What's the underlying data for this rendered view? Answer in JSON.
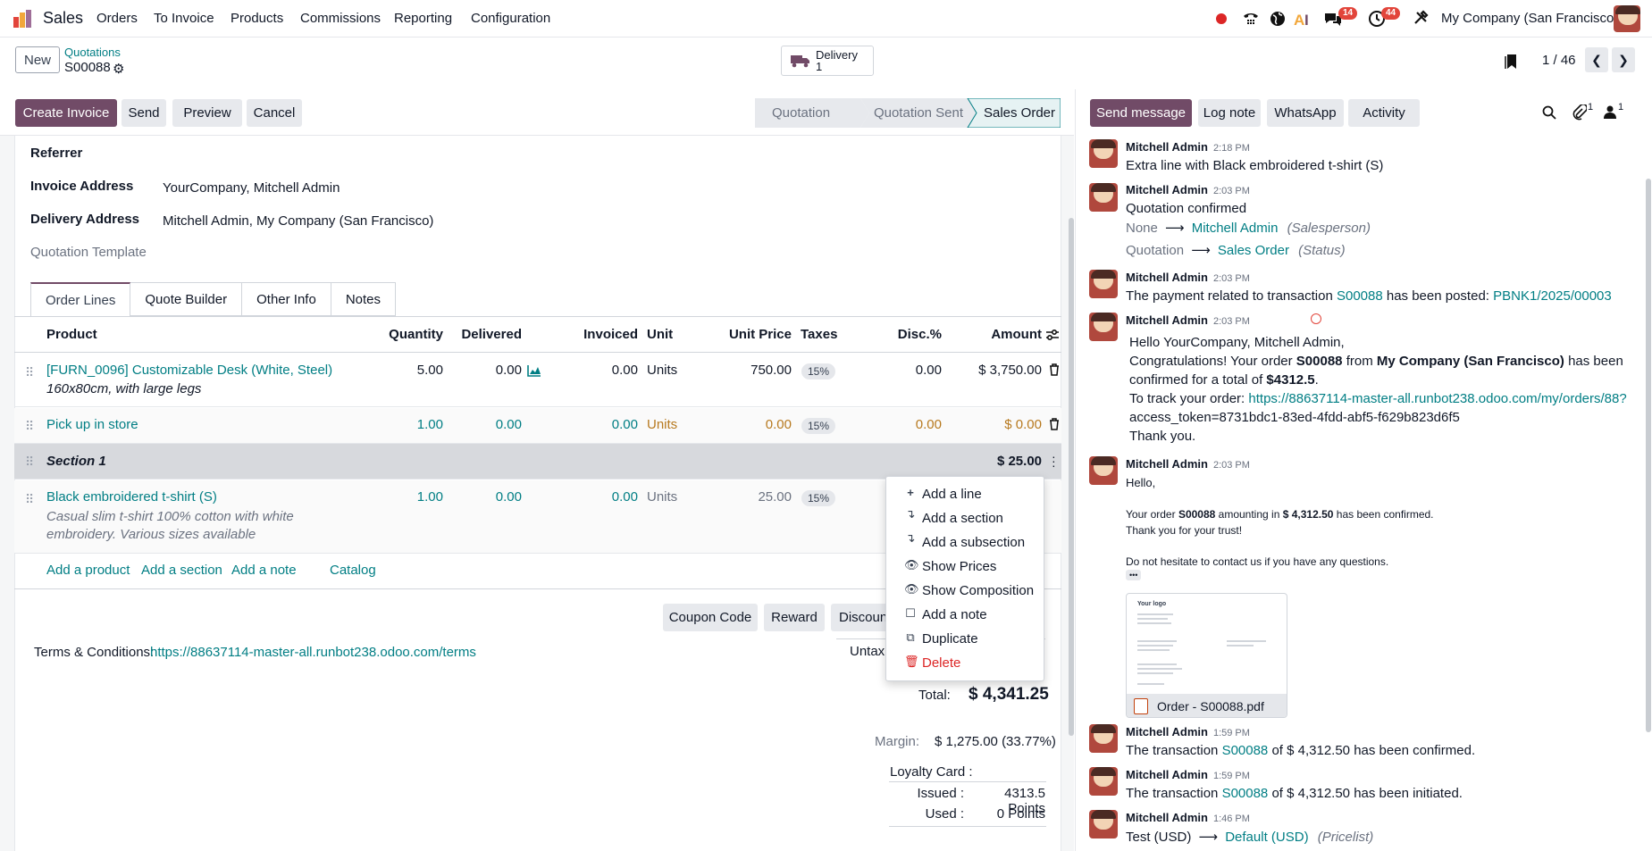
{
  "nav": {
    "app_name": "Sales",
    "menu": [
      "Orders",
      "To Invoice",
      "Products",
      "Commissions",
      "Reporting",
      "Configuration"
    ],
    "chat_count": "14",
    "activity_count": "44",
    "company": "My Company (San Francisco)"
  },
  "control": {
    "new_label": "New",
    "breadcrumb_parent": "Quotations",
    "record_name": "S00088",
    "delivery_label": "Delivery",
    "delivery_count": "1",
    "pager": "1 / 46"
  },
  "actions": {
    "create_invoice": "Create Invoice",
    "send": "Send",
    "preview": "Preview",
    "cancel": "Cancel"
  },
  "status": {
    "steps": [
      "Quotation",
      "Quotation Sent",
      "Sales Order"
    ],
    "active": "Sales Order"
  },
  "fields": {
    "referrer_label": "Referrer",
    "invoice_address_label": "Invoice Address",
    "invoice_address_value": "YourCompany, Mitchell Admin",
    "delivery_address_label": "Delivery Address",
    "delivery_address_value": "Mitchell Admin, My Company (San Francisco)",
    "quotation_template_label": "Quotation Template"
  },
  "tabs": [
    "Order Lines",
    "Quote Builder",
    "Other Info",
    "Notes"
  ],
  "columns": {
    "product": "Product",
    "quantity": "Quantity",
    "delivered": "Delivered",
    "invoiced": "Invoiced",
    "unit": "Unit",
    "unit_price": "Unit Price",
    "taxes": "Taxes",
    "disc": "Disc.%",
    "amount": "Amount"
  },
  "lines": [
    {
      "product": "[FURN_0096] Customizable Desk (White, Steel)",
      "desc": "160x80cm, with large legs",
      "qty": "5.00",
      "delivered": "0.00",
      "invoiced": "0.00",
      "unit": "Units",
      "price": "750.00",
      "tax": "15%",
      "disc": "0.00",
      "amount": "$ 3,750.00"
    },
    {
      "product": "Pick up in store",
      "qty": "1.00",
      "delivered": "0.00",
      "invoiced": "0.00",
      "unit": "Units",
      "price": "0.00",
      "tax": "15%",
      "disc": "0.00",
      "amount": "$ 0.00"
    },
    {
      "section": "Section 1",
      "amount": "$ 25.00"
    },
    {
      "product": "Black embroidered t-shirt (S)",
      "desc1": "Casual slim t-shirt 100% cotton with white",
      "desc2": "embroidery. Various sizes available",
      "qty": "1.00",
      "delivered": "0.00",
      "invoiced": "0.00",
      "unit": "Units",
      "price": "25.00",
      "tax": "15%"
    }
  ],
  "add_links": {
    "product": "Add a product",
    "section": "Add a section",
    "note": "Add a note",
    "catalog": "Catalog"
  },
  "footer_buttons": {
    "coupon": "Coupon Code",
    "reward": "Reward",
    "discount": "Discoun"
  },
  "terms": {
    "label": "Terms & Conditions:",
    "url": "https://88637114-master-all.runbot238.odoo.com/terms"
  },
  "totals": {
    "untaxed_label": "Untax",
    "total_label": "Total:",
    "total_value": "$ 4,341.25",
    "margin_label": "Margin:",
    "margin_value": "$ 1,275.00 (33.77%)",
    "loyalty_label": "Loyalty Card :",
    "issued_label": "Issued :",
    "issued_value": "4313.5 Points",
    "used_label": "Used :",
    "used_value": "0 Points"
  },
  "context_menu": [
    "Add a line",
    "Add a section",
    "Add a subsection",
    "Show Prices",
    "Show Composition",
    "Add a note",
    "Duplicate",
    "Delete"
  ],
  "chatter": {
    "send_message": "Send message",
    "log_note": "Log note",
    "whatsapp": "WhatsApp",
    "activity": "Activity",
    "attachments_count": "1",
    "followers_count": "1"
  },
  "messages": {
    "m1": {
      "author": "Mitchell Admin",
      "time": "2:18 PM",
      "text": "Extra line with Black embroidered t-shirt (S)"
    },
    "m2": {
      "author": "Mitchell Admin",
      "time": "2:03 PM",
      "text": "Quotation confirmed",
      "t1_from": "None",
      "t1_to": "Mitchell Admin",
      "t1_field": "(Salesperson)",
      "t2_from": "Quotation",
      "t2_to": "Sales Order",
      "t2_field": "(Status)"
    },
    "m3": {
      "author": "Mitchell Admin",
      "time": "2:03 PM",
      "pre": "The payment related to transaction",
      "ref": "S00088",
      "mid": "has been posted:",
      "link": "PBNK1/2025/00003"
    },
    "m4": {
      "author": "Mitchell Admin",
      "time": "2:03 PM",
      "l1": "Hello YourCompany, Mitchell Admin,",
      "l2a": "Congratulations! Your order",
      "l2b": "S00088",
      "l2c": "from",
      "l2d": "My Company (San Francisco)",
      "l2e": "has been",
      "l3a": "confirmed for a total of",
      "l3b": "$4312.5",
      "l3c": ".",
      "l4a": "To track your order:",
      "l4b": "https://88637114-master-all.runbot238.odoo.com/my/orders/88?",
      "l5": "access_token=8731bdc1-83ed-4fdd-abf5-f629b823d6f5",
      "l6": "Thank you."
    },
    "m5": {
      "author": "Mitchell Admin",
      "time": "2:03 PM",
      "l1": "Hello,",
      "l2a": "Your order",
      "l2b": "S00088",
      "l2c": "amounting in",
      "l2d": "$ 4,312.50",
      "l2e": "has been confirmed.",
      "l3": "Thank you for your trust!",
      "l4": "Do not hesitate to contact us if you have any questions.",
      "more": "•••",
      "logo_text": "Your logo",
      "attachment": "Order - S00088.pdf"
    },
    "m6": {
      "author": "Mitchell Admin",
      "time": "1:59 PM",
      "pre": "The transaction",
      "ref": "S00088",
      "post": "of $ 4,312.50 has been confirmed."
    },
    "m7": {
      "author": "Mitchell Admin",
      "time": "1:59 PM",
      "pre": "The transaction",
      "ref": "S00088",
      "post": "of $ 4,312.50 has been initiated."
    },
    "m8": {
      "author": "Mitchell Admin",
      "time": "1:46 PM",
      "from": "Test (USD)",
      "to": "Default (USD)",
      "field": "(Pricelist)"
    }
  }
}
